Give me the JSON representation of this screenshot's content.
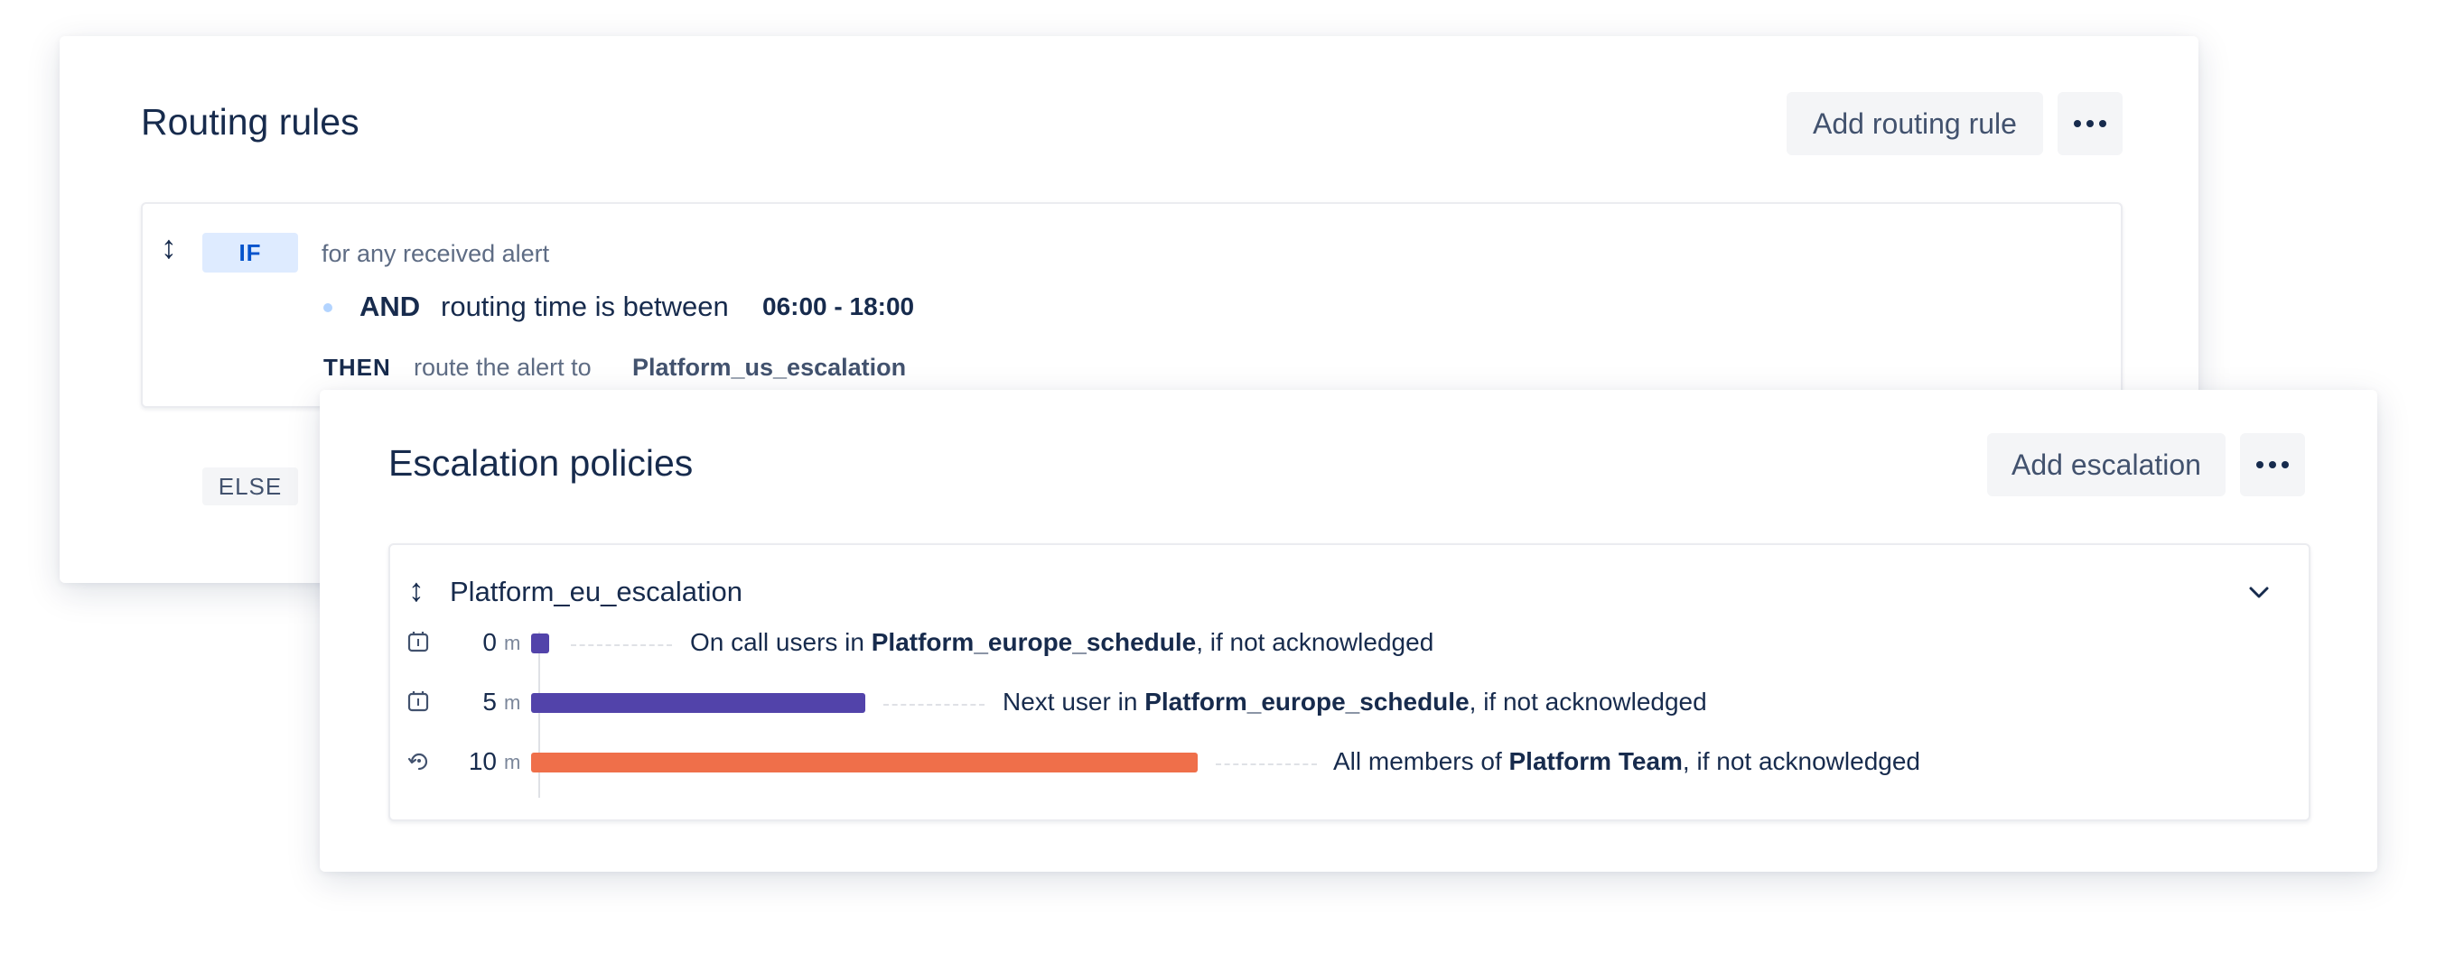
{
  "routing": {
    "title": "Routing rules",
    "add_button": "Add routing rule",
    "rule": {
      "if_tag": "IF",
      "if_text": "for any received alert",
      "and_label": "AND",
      "and_text": "routing time is between",
      "time_range": "06:00 - 18:00",
      "then_label": "THEN",
      "then_text": "route the alert to",
      "then_target": "Platform_us_escalation"
    },
    "else_tag": "ELSE"
  },
  "escalation": {
    "title": "Escalation policies",
    "add_button": "Add escalation",
    "policy": {
      "name": "Platform_eu_escalation",
      "steps": [
        {
          "icon": "clock-icon",
          "delay": "0",
          "unit": "m",
          "prefix": "On call users in",
          "target": "Platform_europe_schedule",
          "suffix": ", if not acknowledged",
          "color": "#5243aa"
        },
        {
          "icon": "clock-icon",
          "delay": "5",
          "unit": "m",
          "prefix": "Next user in",
          "target": "Platform_europe_schedule",
          "suffix": ", if not acknowledged",
          "color": "#5243aa"
        },
        {
          "icon": "repeat-icon",
          "delay": "10",
          "unit": "m",
          "prefix": "All members of",
          "target": "Platform Team",
          "suffix": ", if not acknowledged",
          "color": "#ef6f4a"
        }
      ]
    }
  },
  "colors": {
    "if_tag_bg": "#deebff",
    "if_tag_text": "#0052cc",
    "else_tag_bg": "#f4f5f7",
    "purple": "#5243aa",
    "orange": "#ef6f4a"
  }
}
